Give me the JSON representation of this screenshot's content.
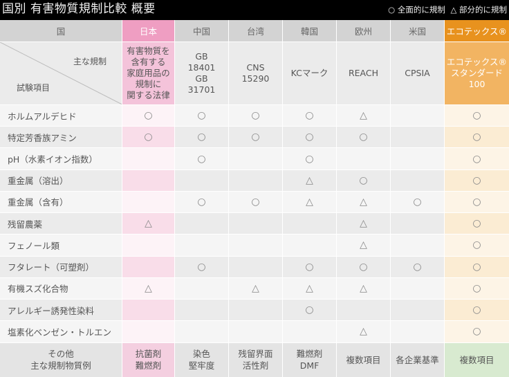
{
  "title": "国別 有害物質規制比較 概要",
  "legend": {
    "circle_label": "○ 全面的に規制",
    "triangle_label": "△ 部分的に規制"
  },
  "columns": [
    "国",
    "日本",
    "中国",
    "台湾",
    "韓国",
    "欧州",
    "米国",
    "エコテックス®"
  ],
  "header_diagonal": {
    "rules_label": "主な規制",
    "items_label": "試験項目"
  },
  "regulations": [
    "有害物質を\n含有する\n家庭用品の\n規制に\n関する法律",
    "GB\n18401\nGB\n31701",
    "CNS\n15290",
    "KCマーク",
    "REACH",
    "CPSIA",
    "エコテックス®\nスタンダード\n100"
  ],
  "rows": [
    {
      "item": "ホルムアルデヒド",
      "marks": [
        "○",
        "○",
        "○",
        "○",
        "△",
        "",
        "○"
      ]
    },
    {
      "item": "特定芳香族アミン",
      "marks": [
        "○",
        "○",
        "○",
        "○",
        "○",
        "",
        "○"
      ]
    },
    {
      "item": "pH（水素イオン指数）",
      "marks": [
        "",
        "○",
        "",
        "○",
        "",
        "",
        "○"
      ]
    },
    {
      "item": "重金属（溶出）",
      "marks": [
        "",
        "",
        "",
        "△",
        "○",
        "",
        "○"
      ]
    },
    {
      "item": "重金属（含有）",
      "marks": [
        "",
        "○",
        "○",
        "△",
        "△",
        "○",
        "○"
      ]
    },
    {
      "item": "残留農薬",
      "marks": [
        "△",
        "",
        "",
        "",
        "△",
        "",
        "○"
      ]
    },
    {
      "item": "フェノール類",
      "marks": [
        "",
        "",
        "",
        "",
        "△",
        "",
        "○"
      ]
    },
    {
      "item": "フタレート（可塑剤）",
      "marks": [
        "",
        "○",
        "",
        "○",
        "○",
        "○",
        "○"
      ]
    },
    {
      "item": "有機スズ化合物",
      "marks": [
        "△",
        "",
        "△",
        "△",
        "△",
        "",
        "○"
      ]
    },
    {
      "item": "アレルギー誘発性染料",
      "marks": [
        "",
        "",
        "",
        "○",
        "",
        "",
        "○"
      ]
    },
    {
      "item": "塩素化ベンゼン・トルエン",
      "marks": [
        "",
        "",
        "",
        "",
        "△",
        "",
        "○"
      ]
    }
  ],
  "other": {
    "label": "その他\n主な規制物質例",
    "values": [
      "抗菌剤\n難燃剤",
      "染色\n堅牢度",
      "残留界面\n活性剤",
      "難燃剤\nDMF",
      "複数項目",
      "各企業基準",
      "複数項目"
    ]
  },
  "colors": {
    "japan_header": "#ef9ec2",
    "oekotex_header": "#e8921e",
    "oekotex_other": "#d8ead0",
    "title_bar": "#000000"
  }
}
